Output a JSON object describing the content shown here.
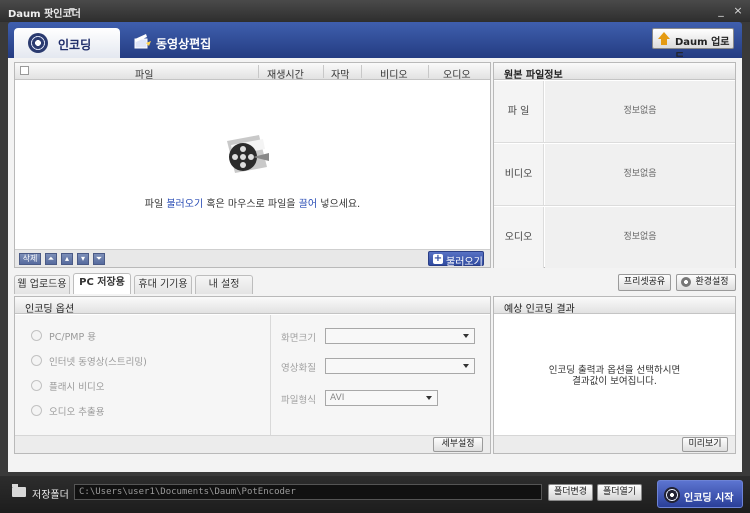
{
  "window": {
    "title": "Daum 팟인코더",
    "minimize_glyph": "_",
    "close_glyph": "×"
  },
  "top_tabs": [
    {
      "label": "인코딩",
      "icon": "film-reel-icon",
      "active": true
    },
    {
      "label": "동영상편집",
      "icon": "clapper-magic-icon",
      "active": false
    }
  ],
  "daum_upload_label": "Daum 업로드",
  "file_table": {
    "columns": [
      "파일",
      "재생시간",
      "자막",
      "비디오",
      "오디오"
    ],
    "empty_text_pre": "파일 ",
    "empty_text_link1": "불러오기",
    "empty_text_mid": " 혹은 마우스로 파일을 ",
    "empty_text_link2": "끌어",
    "empty_text_post": " 넣으세요.",
    "delete_label": "삭제",
    "load_label": "불러오기"
  },
  "source_info": {
    "title": "원본 파일정보",
    "rows": [
      {
        "key": "파  일",
        "value": "정보없음"
      },
      {
        "key": "비디오",
        "value": "정보없음"
      },
      {
        "key": "오디오",
        "value": "정보없음"
      }
    ]
  },
  "sub_tabs": [
    {
      "label": "웹 업로드용",
      "active": false
    },
    {
      "label": "PC 저장용",
      "active": true
    },
    {
      "label": "휴대 기기용",
      "active": false
    },
    {
      "label": "내 설정",
      "active": false
    }
  ],
  "preset_share_label": "프리셋공유",
  "env_settings_label": "환경설정",
  "encoding_options": {
    "title": "인코딩 옵션",
    "radios": [
      "PC/PMP 용",
      "인터넷 동영상(스트리밍)",
      "플래시 비디오",
      "오디오 추출용"
    ],
    "fields": [
      {
        "label": "화면크기",
        "value": ""
      },
      {
        "label": "영상화질",
        "value": ""
      },
      {
        "label": "파일형식",
        "value": "AVI"
      }
    ],
    "detail_label": "세부설정"
  },
  "expected_result": {
    "title": "예상 인코딩 결과",
    "line1": "인코딩 출력과 옵션을 선택하시면",
    "line2": "결과값이 보여집니다.",
    "preview_label": "미리보기"
  },
  "bottom": {
    "save_folder_label": "저장폴더",
    "save_path": "C:\\Users\\user1\\Documents\\Daum\\PotEncoder",
    "change_folder_label": "폴더변경",
    "open_folder_label": "폴더열기",
    "start_label": "인코딩 시작"
  }
}
